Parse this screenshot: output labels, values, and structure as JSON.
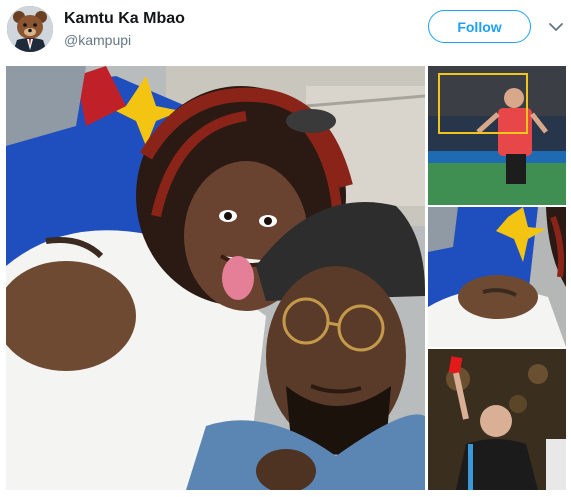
{
  "author": {
    "display_name": "Kamtu Ka Mbao",
    "handle": "@kampupi"
  },
  "actions": {
    "follow_label": "Follow"
  },
  "icons": {
    "avatar": "bear-avatar-icon",
    "menu": "chevron-down-icon"
  },
  "colors": {
    "accent": "#1da1f2",
    "name_text": "#14171a",
    "handle_text": "#657786"
  }
}
